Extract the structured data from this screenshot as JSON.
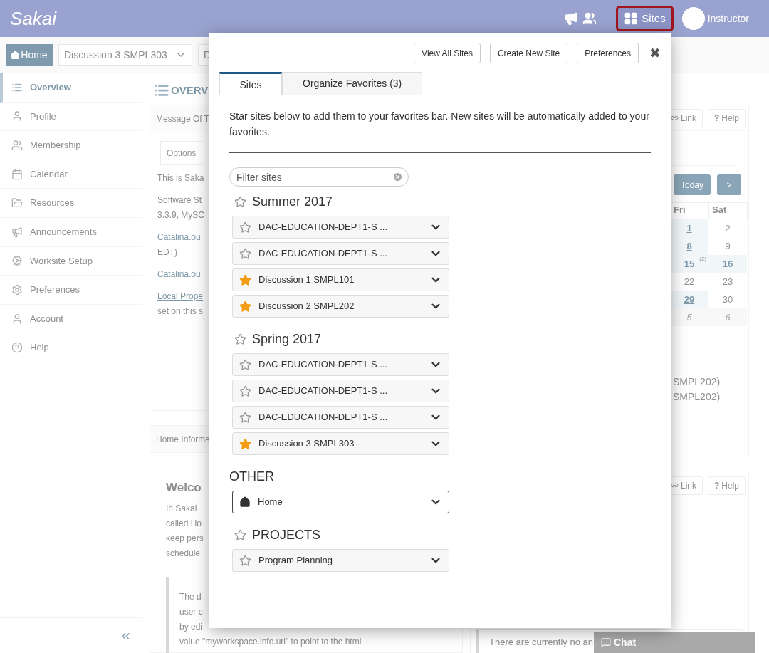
{
  "topbar": {
    "logo": "Sakai",
    "sites_button": {
      "label": "Sites",
      "highlighted": true
    },
    "user": "Instructor"
  },
  "nav": {
    "home": "Home",
    "site_tab": "Discussion 3 SMPL303",
    "next_tab": "D"
  },
  "sidebar": {
    "items": [
      {
        "label": "Overview",
        "selected": true
      },
      {
        "label": "Profile",
        "selected": false
      },
      {
        "label": "Membership",
        "selected": false
      },
      {
        "label": "Calendar",
        "selected": false
      },
      {
        "label": "Resources",
        "selected": false
      },
      {
        "label": "Announcements",
        "selected": false
      },
      {
        "label": "Worksite Setup",
        "selected": false
      },
      {
        "label": "Preferences",
        "selected": false
      },
      {
        "label": "Account",
        "selected": false
      },
      {
        "label": "Help",
        "selected": false
      }
    ],
    "collapse": "«"
  },
  "main": {
    "title": "OVERV",
    "message_panel": {
      "title": "Message Of T",
      "options_tab": "Options",
      "paragraphs": [
        {
          "kind": "text",
          "lines": [
            "This is Saka"
          ]
        },
        {
          "kind": "text",
          "lines": [
            "Software St",
            "3.3.9, MySC"
          ]
        },
        {
          "kind": "link",
          "lines": [
            "Catalina.ou",
            "EDT)"
          ]
        },
        {
          "kind": "link",
          "lines": [
            "Catalina.ou"
          ]
        },
        {
          "kind": "link",
          "lines": [
            "Local Prope",
            "set on this s"
          ]
        }
      ]
    },
    "info_panel": {
      "title": "Home Informa",
      "heading": "Welco",
      "lines": [
        "In Sakai",
        "called Ho",
        "keep pers",
        "schedule"
      ],
      "quote_lines": [
        "The d",
        "user c",
        "by edi",
        "value \"myworkspace.info.url\" to point to the html"
      ]
    },
    "calendar_panel": {
      "link": "Link",
      "help_icon": "?",
      "help": "Help",
      "today": "Today",
      "next": ">",
      "columns": [
        "Fri",
        "Sat"
      ],
      "rows": [
        [
          {
            "day": "1",
            "has_events": true,
            "other_month": false
          },
          {
            "day": "2",
            "has_events": false,
            "other_month": false
          }
        ],
        [
          {
            "day": "8",
            "has_events": true,
            "other_month": false
          },
          {
            "day": "9",
            "has_events": false,
            "other_month": false
          }
        ],
        [
          {
            "day": "15",
            "has_events": true,
            "other_month": false,
            "count": "(2)"
          },
          {
            "day": "16",
            "has_events": true,
            "other_month": false
          }
        ],
        [
          {
            "day": "22",
            "has_events": false,
            "other_month": false
          },
          {
            "day": "23",
            "has_events": false,
            "other_month": false
          }
        ],
        [
          {
            "day": "29",
            "has_events": true,
            "other_month": false
          },
          {
            "day": "30",
            "has_events": false,
            "other_month": false
          }
        ],
        [
          {
            "day": "5",
            "has_events": false,
            "other_month": true
          },
          {
            "day": "6",
            "has_events": false,
            "other_month": true
          }
        ]
      ],
      "events": [
        "SMPL202)",
        "SMPL202)"
      ]
    },
    "announcements_panel": {
      "link": "Link",
      "help_icon": "?",
      "help": "Help",
      "message": "There are currently no an"
    },
    "chat": "Chat"
  },
  "sites_popup": {
    "actions": [
      "View All Sites",
      "Create New Site",
      "Preferences"
    ],
    "close": "✖",
    "tabs": [
      {
        "label": "Sites",
        "selected": true
      },
      {
        "label": "Organize Favorites (3)",
        "selected": false
      }
    ],
    "intro": "Star sites below to add them to your favorites bar. New sites will be automatically added to your favorites.",
    "filter": {
      "placeholder": "Filter sites"
    },
    "groups": [
      {
        "title": "Summer 2017",
        "starrable": true,
        "sites": [
          {
            "name": "DAC-EDUCATION-DEPT1-S ...",
            "kind": "site",
            "favorite": false
          },
          {
            "name": "DAC-EDUCATION-DEPT1-S ...",
            "kind": "site",
            "favorite": false
          },
          {
            "name": "Discussion 1 SMPL101",
            "kind": "site",
            "favorite": true
          },
          {
            "name": "Discussion 2 SMPL202",
            "kind": "site",
            "favorite": true
          }
        ]
      },
      {
        "title": "Spring 2017",
        "starrable": true,
        "sites": [
          {
            "name": "DAC-EDUCATION-DEPT1-S ...",
            "kind": "site",
            "favorite": false
          },
          {
            "name": "DAC-EDUCATION-DEPT1-S ...",
            "kind": "site",
            "favorite": false
          },
          {
            "name": "DAC-EDUCATION-DEPT1-S ...",
            "kind": "site",
            "favorite": false
          },
          {
            "name": "Discussion 3 SMPL303",
            "kind": "site",
            "favorite": true
          }
        ]
      },
      {
        "title": "OTHER",
        "starrable": false,
        "sites": [
          {
            "name": "Home",
            "kind": "home"
          }
        ]
      },
      {
        "title": "PROJECTS",
        "starrable": true,
        "sites": [
          {
            "name": "Program Planning",
            "kind": "site",
            "favorite": false
          }
        ]
      }
    ]
  }
}
